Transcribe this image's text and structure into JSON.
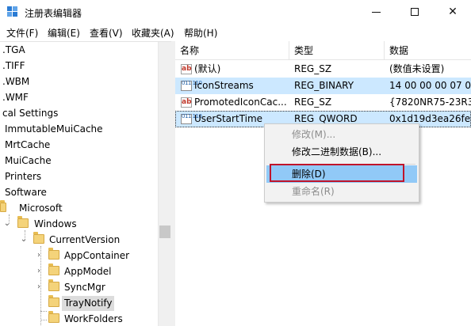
{
  "window": {
    "title": "注册表编辑器",
    "minimize_glyph": "",
    "maximize_glyph": "",
    "close_glyph": "✕"
  },
  "menu": [
    "文件(F)",
    "编辑(E)",
    "查看(V)",
    "收藏夹(A)",
    "帮助(H)"
  ],
  "tree": {
    "items": [
      {
        "label": ".TGA"
      },
      {
        "label": ".TIFF"
      },
      {
        "label": ".WBM"
      },
      {
        "label": ".WMF"
      },
      {
        "label": "cal Settings"
      },
      {
        "label": "ImmutableMuiCache"
      },
      {
        "label": "MrtCache"
      },
      {
        "label": "MuiCache"
      },
      {
        "label": "Printers"
      },
      {
        "label": "Software"
      },
      {
        "label": "Microsoft"
      },
      {
        "label": "Windows"
      },
      {
        "label": "CurrentVersion"
      },
      {
        "label": "AppContainer"
      },
      {
        "label": "AppModel"
      },
      {
        "label": "SyncMgr"
      },
      {
        "label": "TrayNotify"
      },
      {
        "label": "WorkFolders"
      }
    ],
    "expand_glyph": "⌄",
    "collapse_glyph": "›"
  },
  "list": {
    "columns": [
      "名称",
      "类型",
      "数据"
    ],
    "rows": [
      {
        "name": "(默认)",
        "type": "REG_SZ",
        "data": "(数值未设置)",
        "icon": "string-value-icon",
        "icon_glyph": "ab"
      },
      {
        "name": "IconStreams",
        "type": "REG_BINARY",
        "data": "14 00 00 00 07 0",
        "icon": "binary-value-icon",
        "icon_glyph": "011 110"
      },
      {
        "name": "PromotedIconCac...",
        "type": "REG_SZ",
        "data": "{7820NR75-23R3",
        "icon": "string-value-icon",
        "icon_glyph": "ab"
      },
      {
        "name": "UserStartTime",
        "type": "REG_QWORD",
        "data": "0x1d19d3ea26fe",
        "icon": "binary-value-icon",
        "icon_glyph": "011 110"
      }
    ]
  },
  "context_menu": {
    "items": [
      {
        "label": "修改(M)...",
        "enabled": false
      },
      {
        "label": "修改二进制数据(B)...",
        "enabled": true
      },
      {
        "label": "删除(D)",
        "enabled": true,
        "highlighted": true
      },
      {
        "label": "重命名(R)",
        "enabled": false
      }
    ]
  },
  "colors": {
    "row_highlight": "#cce8ff",
    "menu_highlight": "#91c9f7",
    "annotation_box": "#c0142a",
    "folder": "#f4d37a"
  }
}
